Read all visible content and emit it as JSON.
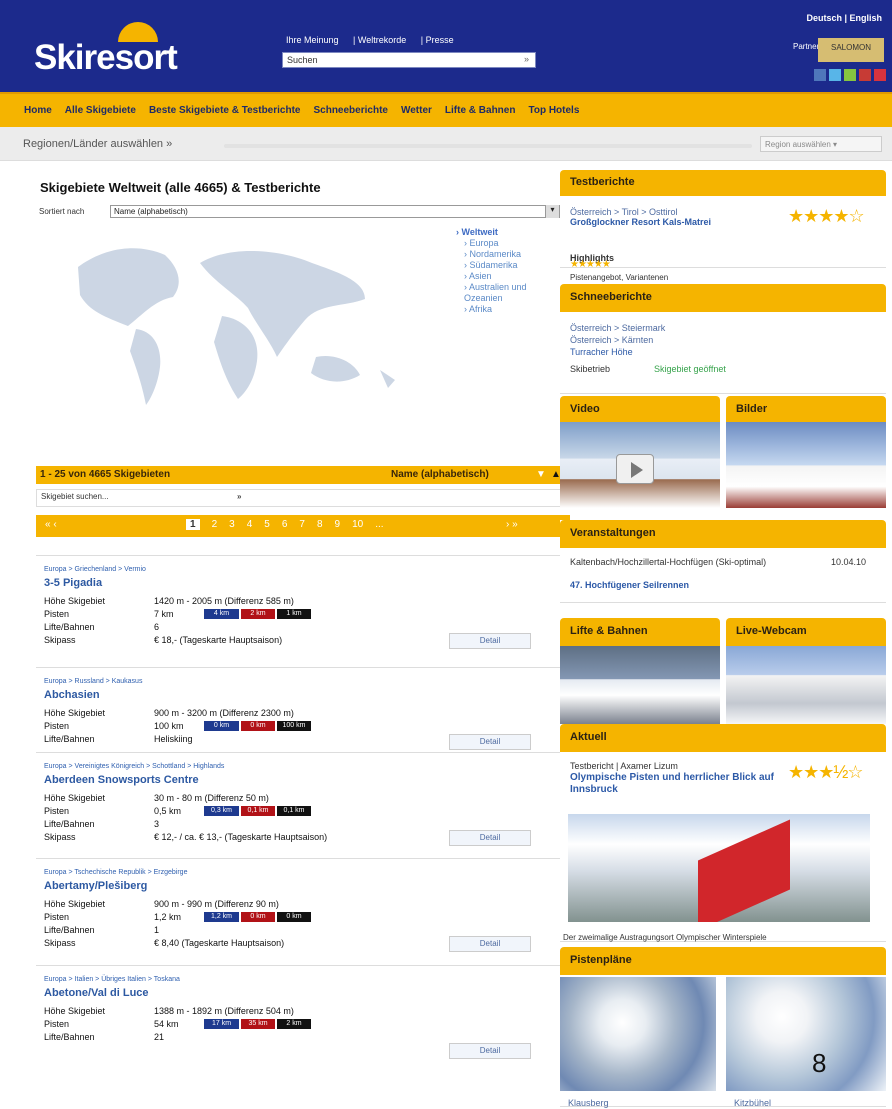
{
  "header": {
    "logo": "Skiresort",
    "links": [
      "Ihre Meinung",
      "Weltrekorde",
      "Presse"
    ],
    "search_placeholder": "Suchen",
    "search_icon": "»",
    "language": "Deutsch | English",
    "partner": "Partner von",
    "partner_logo": "SALOMON"
  },
  "nav": {
    "items": [
      "Home",
      "Alle Skigebiete",
      "Beste Skigebiete & Testberichte",
      "Schneeberichte",
      "Wetter",
      "Lifte & Bahnen",
      "Top Hotels"
    ]
  },
  "regions": {
    "label": "Regionen/Länder auswählen »",
    "select": "Region auswählen ▾"
  },
  "main": {
    "title": "Skigebiete Weltweit (alle 4665) & Testberichte",
    "sort_label": "Sortiert nach",
    "sort_value": "Name (alphabetisch)",
    "world_regions": [
      "Weltweit",
      "Europa",
      "Nordamerika",
      "Südamerika",
      "Asien",
      "Australien und Ozeanien",
      "Afrika"
    ],
    "result_count": "1 - 25 von 4665 Skigebieten",
    "result_sort": "Name (alphabetisch)",
    "search_placeholder": "Skigebiet suchen...",
    "search_go": "»",
    "pager_first": "« ‹",
    "pager_pages": [
      "1",
      "2",
      "3",
      "4",
      "5",
      "6",
      "7",
      "8",
      "9",
      "10",
      "..."
    ],
    "pager_next": "› »"
  },
  "listings": [
    {
      "crumb": "Europa > Griechenland > Vermio",
      "name": "3-5 Pigadia",
      "rows": [
        [
          "Höhe Skigebiet",
          "1420 m - 2005 m (Differenz 585 m)"
        ],
        [
          "Pisten",
          "7 km"
        ],
        [
          "Lifte/Bahnen",
          "6"
        ],
        [
          "Skipass",
          "€ 18,- (Tageskarte Hauptsaison)"
        ]
      ],
      "bars": [
        "4 km",
        "2 km",
        "1 km"
      ],
      "detail": "Detail"
    },
    {
      "crumb": "Europa > Russland > Kaukasus",
      "name": "Abchasien",
      "rows": [
        [
          "Höhe Skigebiet",
          "900 m - 3200 m (Differenz 2300 m)"
        ],
        [
          "Pisten",
          "100 km"
        ],
        [
          "Lifte/Bahnen",
          "Heliskiing"
        ]
      ],
      "bars": [
        "0 km",
        "0 km",
        "100 km"
      ],
      "detail": "Detail"
    },
    {
      "crumb": "Europa > Vereinigtes Königreich > Schottland > Highlands",
      "name": "Aberdeen Snowsports Centre",
      "rows": [
        [
          "Höhe Skigebiet",
          "30 m - 80 m (Differenz 50 m)"
        ],
        [
          "Pisten",
          "0,5 km"
        ],
        [
          "Lifte/Bahnen",
          "3"
        ],
        [
          "Skipass",
          "€ 12,- / ca. € 13,- (Tageskarte Hauptsaison)"
        ]
      ],
      "bars": [
        "0,3 km",
        "0,1 km",
        "0,1 km"
      ],
      "detail": "Detail"
    },
    {
      "crumb": "Europa > Tschechische Republik > Erzgebirge",
      "name": "Abertamy/Plešiberg",
      "rows": [
        [
          "Höhe Skigebiet",
          "900 m - 990 m (Differenz 90 m)"
        ],
        [
          "Pisten",
          "1,2 km"
        ],
        [
          "Lifte/Bahnen",
          "1"
        ],
        [
          "Skipass",
          "€ 8,40 (Tageskarte Hauptsaison)"
        ]
      ],
      "bars": [
        "1,2 km",
        "0 km",
        "0 km"
      ],
      "detail": "Detail"
    },
    {
      "crumb": "Europa > Italien > Übriges Italien > Toskana",
      "name": "Abetone/Val di Luce",
      "rows": [
        [
          "Höhe Skigebiet",
          "1388 m - 1892 m (Differenz 504 m)"
        ],
        [
          "Pisten",
          "54 km"
        ],
        [
          "Lifte/Bahnen",
          "21"
        ]
      ],
      "bars": [
        "17 km",
        "35 km",
        "2 km"
      ],
      "detail": "Detail"
    }
  ],
  "sidebar": {
    "test": {
      "title": "Testberichte",
      "crumb": "Österreich > Tirol > Osttirol",
      "name": "Großglockner Resort Kals-Matrei",
      "sub": "Highlights",
      "cut": "Pistenangebot, Variantenen"
    },
    "snow": {
      "title": "Schneeberichte",
      "lines": [
        "Österreich > Steiermark",
        "Österreich > Kärnten",
        "Turracher Höhe"
      ],
      "status_label": "Skibetrieb",
      "status_value": "Skigebiet geöffnet"
    },
    "video": {
      "title": "Video"
    },
    "photos": {
      "title": "Bilder"
    },
    "events": {
      "title": "Veranstaltungen",
      "place": "Kaltenbach/Hochzillertal-Hochfügen (Ski-optimal)",
      "date": "10.04.10",
      "event": "47. Hochfügener Seilrennen"
    },
    "lifts": {
      "title": "Lifte & Bahnen"
    },
    "webcam": {
      "title": "Live-Webcam"
    },
    "news": {
      "title": "Aktuell",
      "crumb": "Testbericht | Axamer Lizum",
      "headline": "Olympische Pisten und herrlicher Blick auf Innsbruck",
      "caption": "Der zweimalige Austragungsort Olympischer Winterspiele"
    },
    "maps": {
      "title": "Pistenpläne",
      "left": "Klausberg",
      "right": "Kitzbühel"
    }
  },
  "page_number": "8",
  "colors": {
    "brand": "#1c2a8c",
    "accent": "#f5b400",
    "blue": "#1e3a8f",
    "red": "#b11217",
    "black": "#111"
  }
}
